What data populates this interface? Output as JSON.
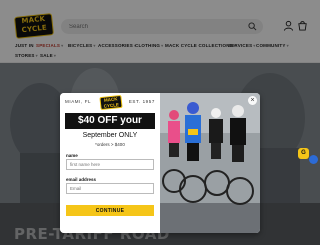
{
  "header": {
    "logo_top": "MACK",
    "logo_bottom": "CYCLE",
    "search": {
      "placeholder": "Search"
    }
  },
  "nav": {
    "items": [
      {
        "label": "JUST IN"
      },
      {
        "label": "SPECIALS",
        "active": true
      },
      {
        "label": "BICYCLES"
      },
      {
        "label": "ACCESSORIES"
      },
      {
        "label": "CLOTHING"
      },
      {
        "label": "MACK CYCLE COLLECTIONS"
      },
      {
        "label": "SERVICES"
      },
      {
        "label": "COMMUNITY"
      },
      {
        "label": "STORES"
      },
      {
        "label": "SALE"
      }
    ]
  },
  "hero": {
    "text": "PRE-TARIFF ROAD"
  },
  "modal": {
    "location": "MIAMI, FL",
    "est": "EST. 1957",
    "logo_top": "MACK",
    "logo_bottom": "CYCLE",
    "offer": "$40 OFF your order",
    "promo": "September ONLY",
    "note": "*orders > $400",
    "name_label": "name",
    "name_placeholder": "first name here",
    "email_label": "email address",
    "email_placeholder": "Email",
    "cta": "CONTINUE",
    "close": "×"
  },
  "widgets": {
    "chat_label": "G"
  },
  "colors": {
    "accent": "#f5c518",
    "dark": "#111111",
    "nav_active": "#c0392b"
  }
}
